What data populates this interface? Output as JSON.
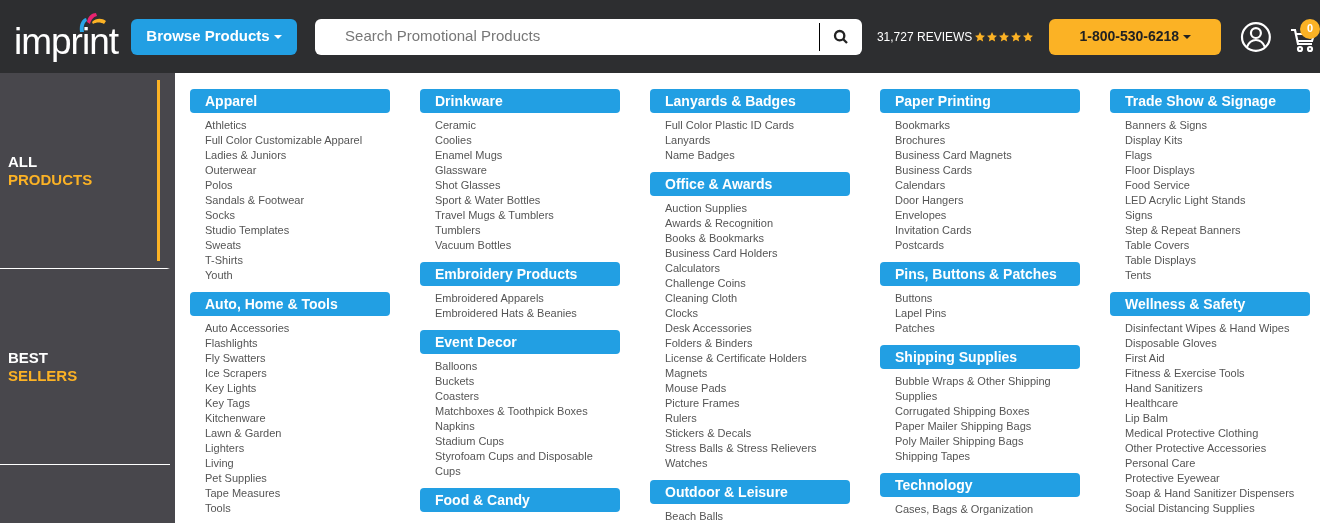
{
  "header": {
    "logo": "imprint",
    "browse_button": "Browse Products",
    "search": {
      "placeholder": "Search Promotional Products"
    },
    "reviews": {
      "text": "31,727 REVIEWS",
      "stars": 5
    },
    "phone_button": "1-800-530-6218",
    "cart_count": "0"
  },
  "sidebar": [
    {
      "line1": "ALL",
      "line2": "PRODUCTS",
      "selected": true
    },
    {
      "line1": "BEST",
      "line2": "SELLERS",
      "selected": false
    }
  ],
  "columns": [
    [
      {
        "title": "Apparel",
        "items": [
          "Athletics",
          "Full Color Customizable Apparel",
          "Ladies & Juniors",
          "Outerwear",
          "Polos",
          "Sandals & Footwear",
          "Socks",
          "Studio Templates",
          "Sweats",
          "T-Shirts",
          "Youth"
        ]
      },
      {
        "title": "Auto, Home & Tools",
        "items": [
          "Auto Accessories",
          "Flashlights",
          "Fly Swatters",
          "Ice Scrapers",
          "Key Lights",
          "Key Tags",
          "Kitchenware",
          "Lawn & Garden",
          "Lighters",
          "Living",
          "Pet Supplies",
          "Tape Measures",
          "Tools"
        ]
      }
    ],
    [
      {
        "title": "Drinkware",
        "items": [
          "Ceramic",
          "Coolies",
          "Enamel Mugs",
          "Glassware",
          "Shot Glasses",
          "Sport & Water Bottles",
          "Travel Mugs & Tumblers",
          "Tumblers",
          "Vacuum Bottles"
        ]
      },
      {
        "title": "Embroidery Products",
        "items": [
          "Embroidered Apparels",
          "Embroidered Hats & Beanies"
        ]
      },
      {
        "title": "Event Decor",
        "items": [
          "Balloons",
          "Buckets",
          "Coasters",
          "Matchboxes & Toothpick Boxes",
          "Napkins",
          "Stadium Cups",
          "Styrofoam Cups and Disposable Cups"
        ]
      },
      {
        "title": "Food & Candy"
      }
    ],
    [
      {
        "title": "Lanyards & Badges",
        "items": [
          "Full Color Plastic ID Cards",
          "Lanyards",
          "Name Badges"
        ]
      },
      {
        "title": "Office & Awards",
        "items": [
          "Auction Supplies",
          "Awards & Recognition",
          "Books & Bookmarks",
          "Business Card Holders",
          "Calculators",
          "Challenge Coins",
          "Cleaning Cloth",
          "Clocks",
          "Desk Accessories",
          "Folders & Binders",
          "License & Certificate Holders",
          "Magnets",
          "Mouse Pads",
          "Picture Frames",
          "Rulers",
          "Stickers & Decals",
          "Stress Balls & Stress Relievers",
          "Watches"
        ]
      },
      {
        "title": "Outdoor & Leisure",
        "items": [
          "Beach Balls"
        ]
      }
    ],
    [
      {
        "title": "Paper Printing",
        "items": [
          "Bookmarks",
          "Brochures",
          "Business Card Magnets",
          "Business Cards",
          "Calendars",
          "Door Hangers",
          "Envelopes",
          "Invitation Cards",
          "Postcards"
        ]
      },
      {
        "title": "Pins, Buttons & Patches",
        "items": [
          "Buttons",
          "Lapel Pins",
          "Patches"
        ]
      },
      {
        "title": "Shipping Supplies",
        "items": [
          "Bubble Wraps & Other Shipping Supplies",
          "Corrugated Shipping Boxes",
          "Paper Mailer Shipping Bags",
          "Poly Mailer Shipping Bags",
          "Shipping Tapes"
        ]
      },
      {
        "title": "Technology",
        "items": [
          "Cases, Bags & Organization"
        ]
      }
    ],
    [
      {
        "title": "Trade Show & Signage",
        "items": [
          "Banners & Signs",
          "Display Kits",
          "Flags",
          "Floor Displays",
          "Food Service",
          "LED Acrylic Light Stands",
          "Signs",
          "Step & Repeat Banners",
          "Table Covers",
          "Table Displays",
          "Tents"
        ]
      },
      {
        "title": "Wellness & Safety",
        "items": [
          "Disinfectant Wipes & Hand Wipes",
          "Disposable Gloves",
          "First Aid",
          "Fitness & Exercise Tools",
          "Hand Sanitizers",
          "Healthcare",
          "Lip Balm",
          "Medical Protective Clothing",
          "Other Protective Accessories",
          "Personal Care",
          "Protective Eyewear",
          "Soap & Hand Sanitizer Dispensers",
          "Social Distancing Supplies"
        ]
      }
    ]
  ]
}
